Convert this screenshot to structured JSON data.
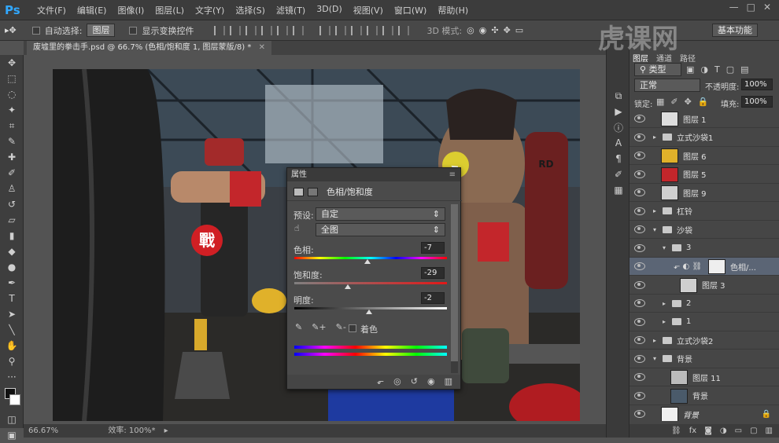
{
  "app": {
    "logo": "Ps"
  },
  "menu": [
    "文件(F)",
    "编辑(E)",
    "图像(I)",
    "图层(L)",
    "文字(Y)",
    "选择(S)",
    "滤镜(T)",
    "3D(D)",
    "视图(V)",
    "窗口(W)",
    "帮助(H)"
  ],
  "options": {
    "auto_select": "自动选择:",
    "auto_select_value": "图层",
    "transform": "显示变换控件",
    "mode3d": "3D 模式:",
    "workspace": "基本功能"
  },
  "doc_tab": "废墟里的拳击手.psd @ 66.7% (色相/饱和度 1, 图层蒙版/8) *",
  "status": {
    "zoom": "66.67%",
    "efficiency": "效率: 100%*"
  },
  "watermark": "虎课网",
  "properties": {
    "panel_title": "属性",
    "adjust_title": "色相/饱和度",
    "preset_label": "预设:",
    "preset_value": "自定",
    "range_value": "全图",
    "hue_label": "色相:",
    "hue_value": "-7",
    "hue_pos": 0.48,
    "sat_label": "饱和度:",
    "sat_value": "-29",
    "sat_pos": 0.35,
    "light_label": "明度:",
    "light_value": "-2",
    "light_pos": 0.49,
    "colorize": "着色"
  },
  "canvas": {
    "emblem": "戰",
    "bag_text": "RD"
  },
  "layers_panel": {
    "tabs": [
      "图层",
      "通道",
      "路径"
    ],
    "filter": "类型",
    "blend": "正常",
    "opacity_label": "不透明度:",
    "opacity": "100%",
    "lock_label": "锁定:",
    "fill_label": "填充:",
    "fill": "100%",
    "layers": [
      {
        "name": "图层 1",
        "kind": "image",
        "indent": 0
      },
      {
        "name": "立式沙袋1",
        "kind": "folder",
        "indent": 0,
        "open": false
      },
      {
        "name": "图层 6",
        "kind": "image",
        "indent": 0
      },
      {
        "name": "图层 5",
        "kind": "image",
        "indent": 0
      },
      {
        "name": "图层 9",
        "kind": "image",
        "indent": 0
      },
      {
        "name": "杠铃",
        "kind": "folder",
        "indent": 0,
        "open": false
      },
      {
        "name": "沙袋",
        "kind": "folder",
        "indent": 0,
        "open": true
      },
      {
        "name": "3",
        "kind": "folder",
        "indent": 1,
        "open": true
      },
      {
        "name": "色相/...",
        "kind": "adjust",
        "indent": 2
      },
      {
        "name": "图层 3",
        "kind": "image",
        "indent": 2
      },
      {
        "name": "2",
        "kind": "folder",
        "indent": 1,
        "open": false
      },
      {
        "name": "1",
        "kind": "folder",
        "indent": 1,
        "open": false
      },
      {
        "name": "立式沙袋2",
        "kind": "folder",
        "indent": 0,
        "open": false
      },
      {
        "name": "背景",
        "kind": "folder",
        "indent": 0,
        "open": true
      },
      {
        "name": "图层 11",
        "kind": "image",
        "indent": 1
      },
      {
        "name": "背景",
        "kind": "image",
        "indent": 1
      },
      {
        "name": "背景",
        "kind": "locked",
        "indent": 0
      }
    ]
  }
}
